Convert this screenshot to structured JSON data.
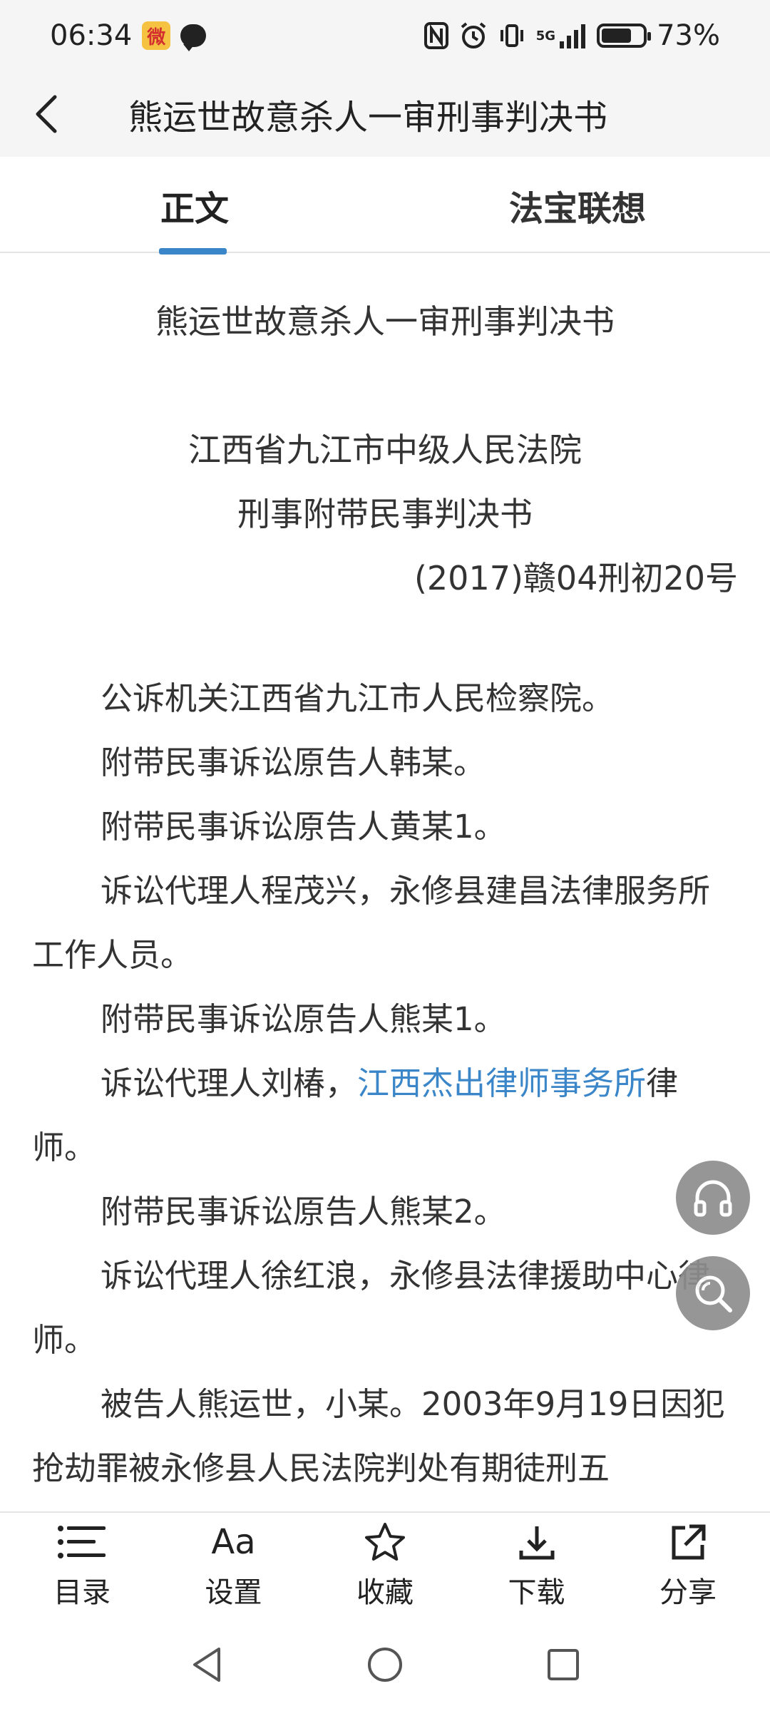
{
  "status_bar": {
    "time": "06:34",
    "battery": "73%",
    "battery_level": 0.73,
    "network": "5G",
    "icons": [
      "weibo-icon",
      "message-icon",
      "nfc-icon",
      "alarm-icon",
      "vibrate-icon",
      "signal-icon",
      "battery-icon"
    ]
  },
  "header": {
    "title": "熊运世故意杀人一审刑事判决书",
    "back_icon": "chevron-left-icon"
  },
  "tabs": [
    {
      "label": "正文",
      "active": true
    },
    {
      "label": "法宝联想",
      "active": false
    }
  ],
  "document": {
    "title": "熊运世故意杀人一审刑事判决书",
    "court": "江西省九江市中级人民法院",
    "doc_type": "刑事附带民事判决书",
    "case_number": "(2017)赣04刑初20号",
    "paragraphs": [
      {
        "text": "公诉机关江西省九江市人民检察院。"
      },
      {
        "text": "附带民事诉讼原告人韩某。"
      },
      {
        "text": "附带民事诉讼原告人黄某1。"
      },
      {
        "text": "诉讼代理人程茂兴，永修县建昌法律服务所工作人员。"
      },
      {
        "text": "附带民事诉讼原告人熊某1。"
      },
      {
        "text_before": "诉讼代理人刘椿，",
        "link": "江西杰出律师事务所",
        "text_after": "律师。"
      },
      {
        "text": "附带民事诉讼原告人熊某2。"
      },
      {
        "text": "诉讼代理人徐红浪，永修县法律援助中心律师。"
      },
      {
        "text": "被告人熊运世，小某。2003年9月19日因犯抢劫罪被永修县人民法院判处有期徒刑五"
      }
    ]
  },
  "floating_buttons": {
    "listen_icon": "headphones-icon",
    "search_icon": "search-icon"
  },
  "bottom_bar": [
    {
      "label": "目录",
      "icon": "list-icon"
    },
    {
      "label": "设置",
      "icon": "font-settings-icon",
      "glyph": "Aa"
    },
    {
      "label": "收藏",
      "icon": "star-icon"
    },
    {
      "label": "下载",
      "icon": "download-icon"
    },
    {
      "label": "分享",
      "icon": "share-icon"
    }
  ],
  "nav_bar": [
    "back-triangle-icon",
    "home-circle-icon",
    "recents-square-icon"
  ],
  "colors": {
    "accent": "#3a86c8",
    "header_bg": "#f5f5f5",
    "fab_bg": "#8e8e8e"
  }
}
